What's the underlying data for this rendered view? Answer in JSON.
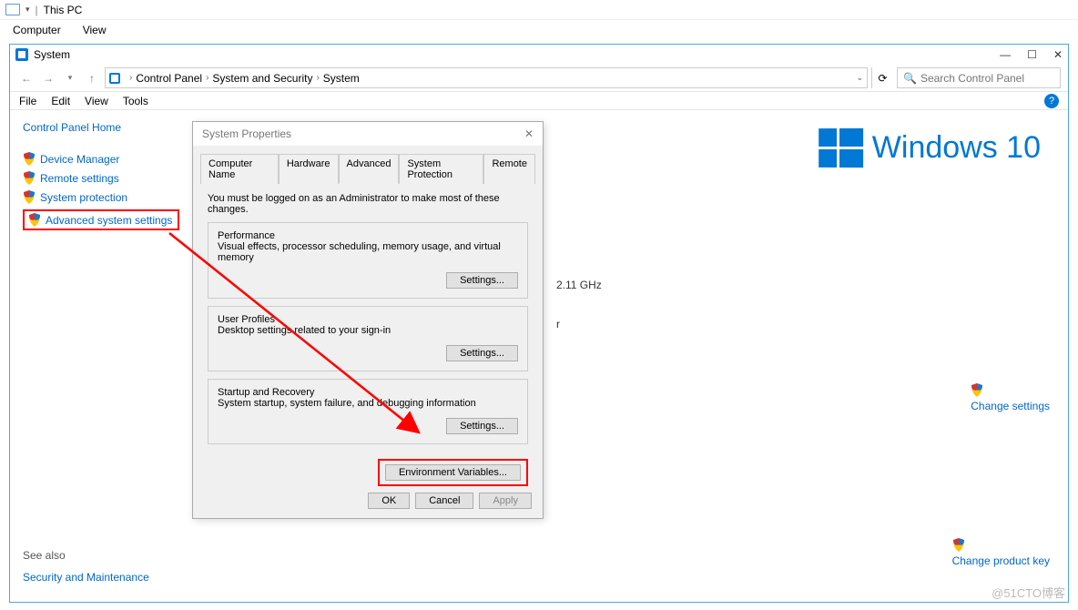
{
  "explorer": {
    "title": "This PC",
    "menu": {
      "computer": "Computer",
      "view": "View"
    }
  },
  "sys": {
    "title": "System",
    "controls": {
      "min": "—",
      "max": "☐",
      "close": "✕"
    },
    "breadcrumbs": [
      "Control Panel",
      "System and Security",
      "System"
    ],
    "search_placeholder": "Search Control Panel",
    "menubar": {
      "file": "File",
      "edit": "Edit",
      "view": "View",
      "tools": "Tools"
    }
  },
  "sidebar": {
    "home": "Control Panel Home",
    "items": [
      {
        "label": "Device Manager"
      },
      {
        "label": "Remote settings"
      },
      {
        "label": "System protection"
      },
      {
        "label": "Advanced system settings"
      }
    ],
    "seealso": "See also",
    "sec_maint": "Security and Maintenance"
  },
  "content": {
    "win10": "Windows 10",
    "freq": "2.11 GHz",
    "change_settings": "Change settings",
    "change_key": "Change product key"
  },
  "modal": {
    "title": "System Properties",
    "tabs": [
      "Computer Name",
      "Hardware",
      "Advanced",
      "System Protection",
      "Remote"
    ],
    "notice": "You must be logged on as an Administrator to make most of these changes.",
    "perf": {
      "legend": "Performance",
      "desc": "Visual effects, processor scheduling, memory usage, and virtual memory",
      "btn": "Settings..."
    },
    "profiles": {
      "legend": "User Profiles",
      "desc": "Desktop settings related to your sign-in",
      "btn": "Settings..."
    },
    "startup": {
      "legend": "Startup and Recovery",
      "desc": "System startup, system failure, and debugging information",
      "btn": "Settings..."
    },
    "env_btn": "Environment Variables...",
    "footer": {
      "ok": "OK",
      "cancel": "Cancel",
      "apply": "Apply"
    }
  },
  "watermark": "@51CTO博客"
}
